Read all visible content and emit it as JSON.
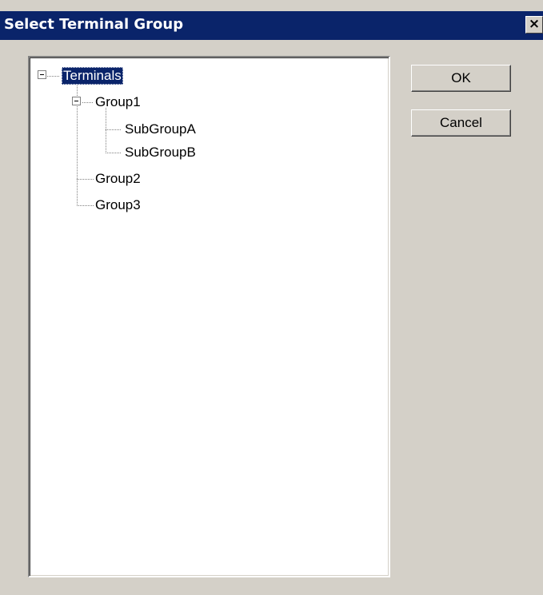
{
  "dialog": {
    "title": "Select Terminal Group",
    "close_label": "✕"
  },
  "tree": {
    "root": {
      "label": "Terminals",
      "selected": true,
      "expanded": true
    },
    "group1": {
      "label": "Group1",
      "expanded": true
    },
    "subgroupA": {
      "label": "SubGroupA"
    },
    "subgroupB": {
      "label": "SubGroupB"
    },
    "group2": {
      "label": "Group2"
    },
    "group3": {
      "label": "Group3"
    }
  },
  "buttons": {
    "ok_label": "OK",
    "cancel_label": "Cancel"
  },
  "colors": {
    "titlebar": "#0a246a",
    "face": "#d4d0c8",
    "selection": "#0a246a"
  }
}
